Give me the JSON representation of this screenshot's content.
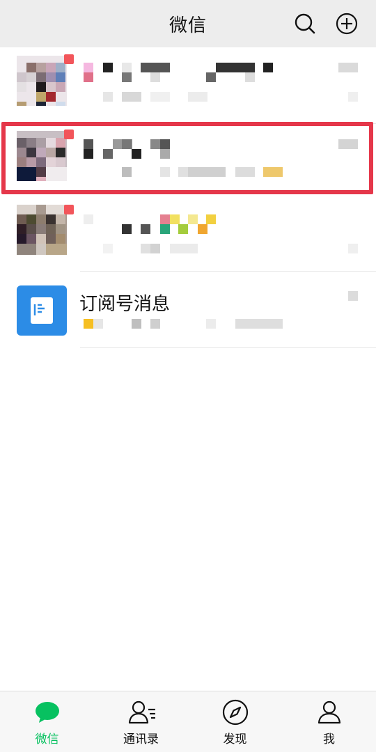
{
  "header": {
    "title": "微信",
    "search_icon": "search-icon",
    "add_icon": "plus-circle-icon"
  },
  "chats": [
    {
      "name": "",
      "preview": "",
      "time": "",
      "unread": true
    },
    {
      "name": "",
      "preview": "",
      "time": "",
      "unread": true,
      "highlighted": true
    },
    {
      "name": "",
      "preview": "",
      "time": "",
      "unread": true
    },
    {
      "name": "订阅号消息",
      "preview": "",
      "time": "",
      "icon": "document-icon"
    }
  ],
  "tabs": [
    {
      "label": "微信",
      "icon": "chat-bubble-icon",
      "active": true
    },
    {
      "label": "通讯录",
      "icon": "contacts-icon",
      "active": false
    },
    {
      "label": "发现",
      "icon": "compass-icon",
      "active": false
    },
    {
      "label": "我",
      "icon": "person-icon",
      "active": false
    }
  ],
  "colors": {
    "accent_green": "#07c160",
    "badge_red": "#f2555a",
    "highlight_red": "#e5374a",
    "subscription_blue": "#2c8ce6",
    "header_bg": "#ededed"
  }
}
